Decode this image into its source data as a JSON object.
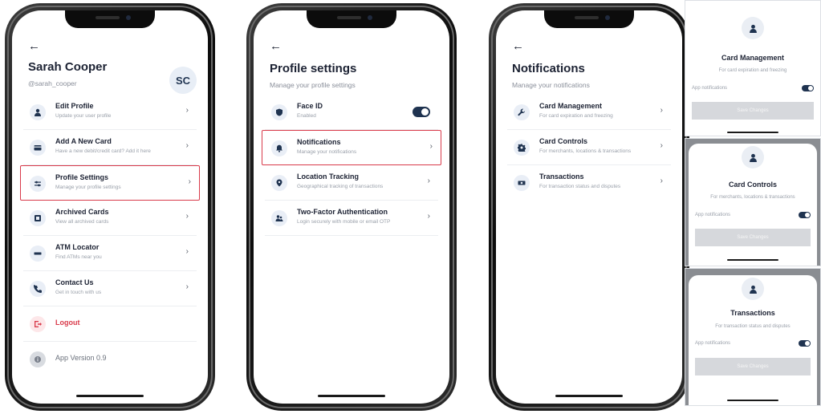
{
  "screen1": {
    "back": "←",
    "name": "Sarah Cooper",
    "handle": "@sarah_cooper",
    "avatar": "SC",
    "items": [
      {
        "title": "Edit Profile",
        "subtitle": "Update your user profile",
        "icon": "user-icon"
      },
      {
        "title": "Add A New Card",
        "subtitle": "Have a new debit/credit card? Add it here",
        "icon": "card-icon"
      },
      {
        "title": "Profile Settings",
        "subtitle": "Manage your profile settings",
        "icon": "sliders-icon"
      },
      {
        "title": "Archived Cards",
        "subtitle": "View all archived cards",
        "icon": "archive-icon"
      },
      {
        "title": "ATM Locator",
        "subtitle": "Find ATMs near you",
        "icon": "atm-icon"
      },
      {
        "title": "Contact Us",
        "subtitle": "Get in touch with us",
        "icon": "phone-icon"
      }
    ],
    "logout": "Logout",
    "version": "App Version 0.9",
    "chevron": "›"
  },
  "screen2": {
    "back": "←",
    "title": "Profile settings",
    "subtitle": "Manage your profile settings",
    "items": [
      {
        "title": "Face ID",
        "subtitle": "Enabled",
        "icon": "shield-icon"
      },
      {
        "title": "Notifications",
        "subtitle": "Manage your notifications",
        "icon": "bell-icon"
      },
      {
        "title": "Location Tracking",
        "subtitle": "Geographical tracking of transactions",
        "icon": "location-pin-icon"
      },
      {
        "title": "Two-Factor Authentication",
        "subtitle": "Login securely with mobile or email OTP",
        "icon": "users-icon"
      }
    ],
    "chevron": "›"
  },
  "screen3": {
    "back": "←",
    "title": "Notifications",
    "subtitle": "Manage your notifications",
    "items": [
      {
        "title": "Card Management",
        "subtitle": "For card expiration and freezing",
        "icon": "wrench-icon"
      },
      {
        "title": "Card Controls",
        "subtitle": "For merchants, locations & transactions",
        "icon": "gear-icon"
      },
      {
        "title": "Transactions",
        "subtitle": "For transaction status and disputes",
        "icon": "money-icon"
      }
    ],
    "chevron": "›"
  },
  "cards": [
    {
      "title": "Card Management",
      "subtitle": "For card expiration and freezing",
      "toggle_label": "App notifications",
      "button": "Save Changes"
    },
    {
      "title": "Card Controls",
      "subtitle": "For merchants, locations & transactions",
      "toggle_label": "App notifications",
      "button": "Save Changes"
    },
    {
      "title": "Transactions",
      "subtitle": "For transaction status and disputes",
      "toggle_label": "App notifications",
      "button": "Save Changes"
    }
  ],
  "colors": {
    "accent": "#1f3350",
    "highlight": "#d93a4a",
    "danger": "#d93a4a"
  }
}
